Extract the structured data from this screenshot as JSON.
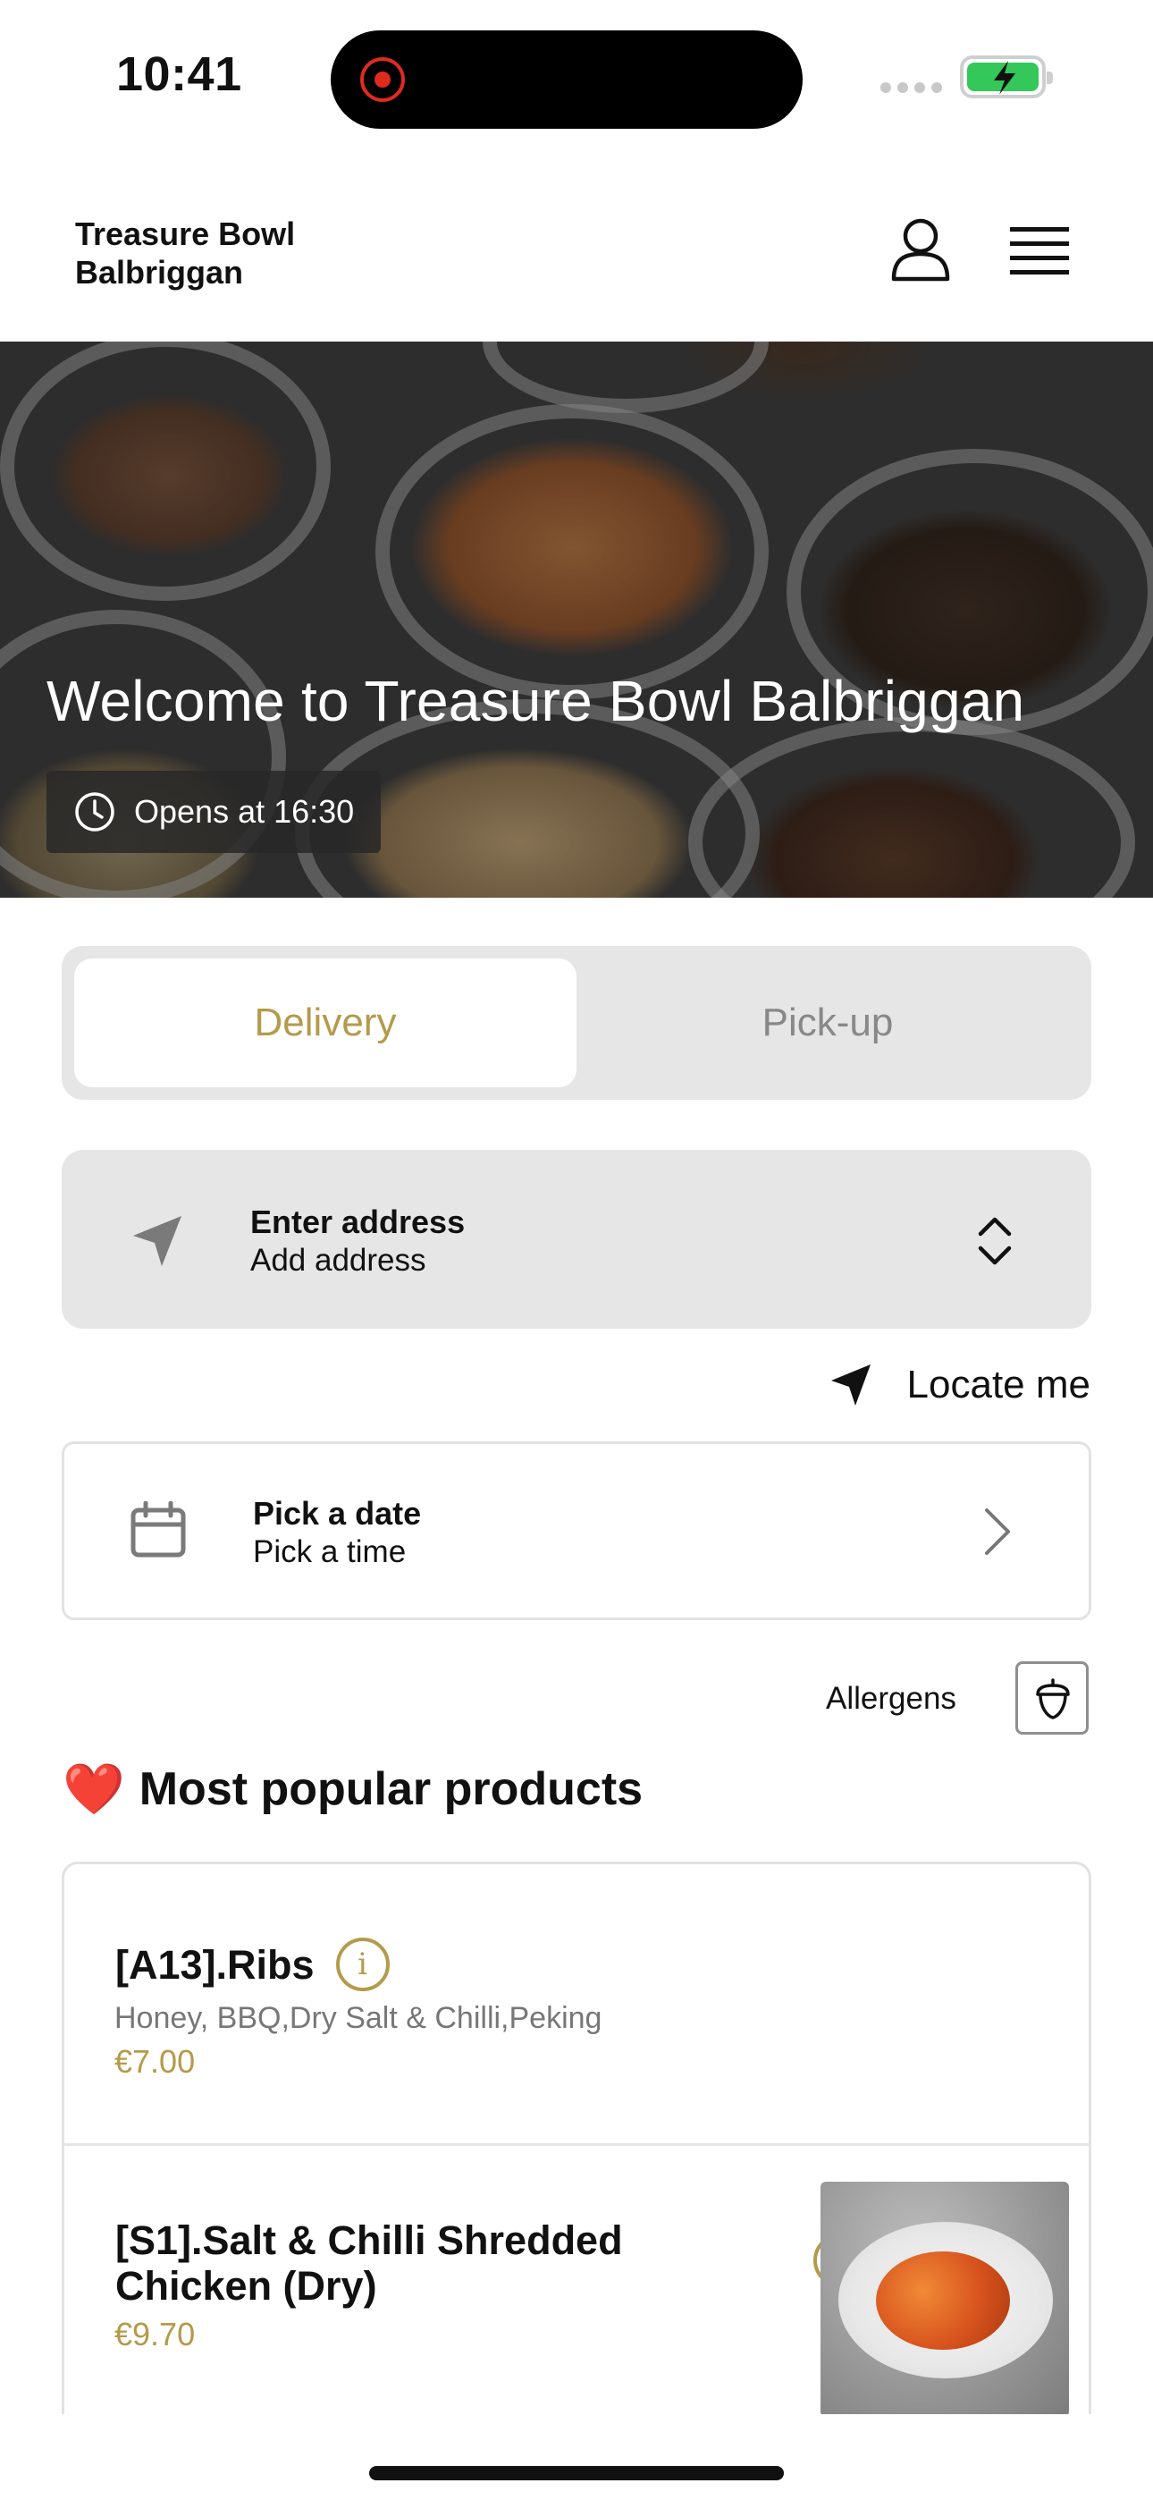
{
  "status_bar": {
    "time": "10:41"
  },
  "header": {
    "restaurant_name": "Treasure Bowl\nBalbriggan"
  },
  "hero": {
    "title": "Welcome to Treasure Bowl Balbriggan",
    "opening_hours": "Opens at 16:30"
  },
  "order_mode": {
    "tabs": [
      {
        "label": "Delivery",
        "selected": true
      },
      {
        "label": "Pick-up",
        "selected": false
      }
    ]
  },
  "address": {
    "title": "Enter address",
    "subtitle": "Add address"
  },
  "locate": {
    "label": "Locate me"
  },
  "schedule": {
    "title": "Pick a date",
    "subtitle": "Pick a time"
  },
  "allergens": {
    "label": "Allergens"
  },
  "popular": {
    "emoji": "❤️",
    "title": "Most popular products",
    "products": [
      {
        "name": "[A13].Ribs",
        "description": "Honey, BBQ,Dry Salt & Chilli,Peking",
        "price": "€7.00"
      },
      {
        "name": "[S1].Salt & Chilli Shredded Chicken (Dry)",
        "price": "€9.70"
      }
    ]
  },
  "colors": {
    "accent": "#b49a4b",
    "panel": "#e6e6e6",
    "battery": "#34c759",
    "recording": "#e02a20"
  }
}
